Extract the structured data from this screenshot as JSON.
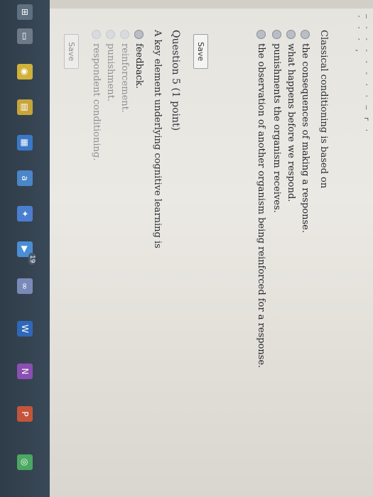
{
  "header": {
    "topline": "– - - - - - ·  · ‒ r · · · · ,"
  },
  "question4": {
    "prompt": "Classical conditioning is based on",
    "options": [
      "the consequences of making a response.",
      "what happens before we respond.",
      "punishments the organism receives.",
      "the observation of another organism being reinforced for a response."
    ],
    "save_label": "Save"
  },
  "question5": {
    "title": "Question 5 (1 point)",
    "prompt": "A key element underlying cognitive learning is",
    "options": [
      "feedback.",
      "reinforcement.",
      "punishment.",
      "respondent conditioning."
    ],
    "save_label": "Save"
  },
  "taskbar": {
    "icons": [
      {
        "name": "windows-icon",
        "color": "#5f7080",
        "glyph": "⊞"
      },
      {
        "name": "multitask-icon",
        "color": "#6d7a88",
        "glyph": "▭"
      },
      {
        "name": "chrome-icon",
        "color": "#d0b23a",
        "glyph": "◉"
      },
      {
        "name": "file-explorer-icon",
        "color": "#c8a53a",
        "glyph": "▤"
      },
      {
        "name": "store-icon",
        "color": "#3c78c8",
        "glyph": "▦"
      },
      {
        "name": "amazon-icon",
        "color": "#4a86c8",
        "glyph": "a"
      },
      {
        "name": "dropbox-icon",
        "color": "#4a7fd0",
        "glyph": "✦"
      },
      {
        "name": "media-icon",
        "color": "#4a8ed6",
        "glyph": "▶"
      },
      {
        "name": "loop-icon",
        "color": "#7a8ab8",
        "glyph": "∞"
      },
      {
        "name": "word-icon",
        "color": "#2f68b8",
        "glyph": "W"
      },
      {
        "name": "onenote-icon",
        "color": "#8a4fb0",
        "glyph": "N"
      },
      {
        "name": "powerpoint-icon",
        "color": "#c4553a",
        "glyph": "P"
      },
      {
        "name": "chrome-app-icon",
        "color": "#4aa862",
        "glyph": "◎"
      }
    ],
    "badge": "19"
  }
}
